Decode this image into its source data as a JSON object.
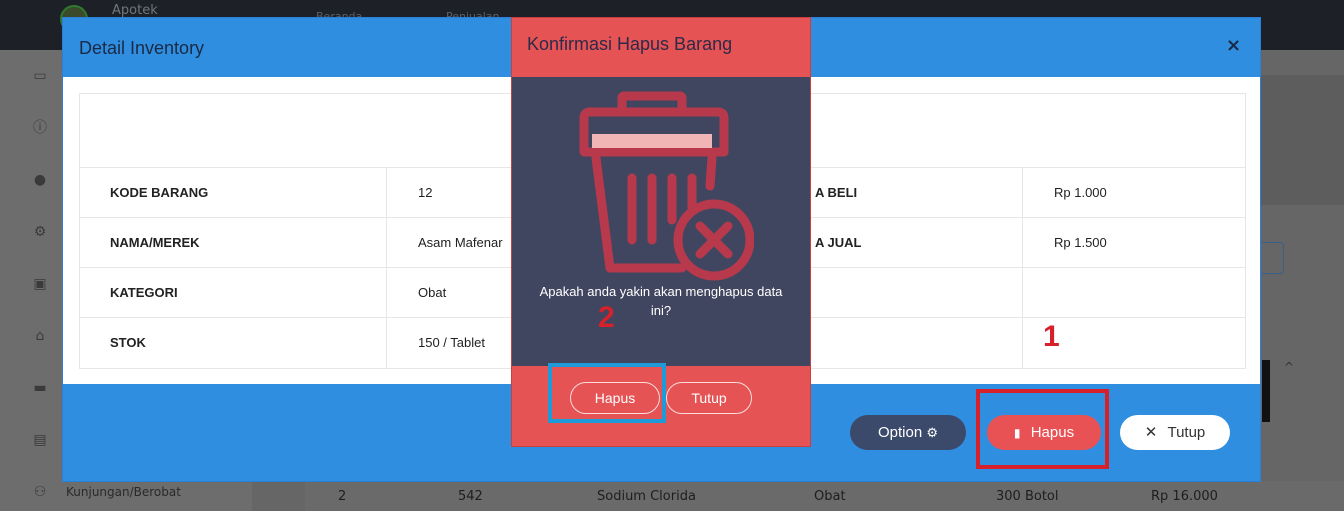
{
  "background": {
    "brand": "Apotek",
    "nav": [
      "Beranda",
      "Penjualan"
    ],
    "sidebar_item_label": "Kunjungan/Berobat",
    "table_row": [
      "2",
      "542",
      "Sodium Clorida",
      "Obat",
      "300 Botol",
      "Rp 16.000"
    ]
  },
  "modal": {
    "title": "Detail Inventory",
    "close": "×",
    "rows": [
      {
        "label": "KODE BARANG",
        "value": "12",
        "label2": "A BELI",
        "value2": "Rp 1.000"
      },
      {
        "label": "NAMA/MEREK",
        "value": "Asam Mafenar",
        "label2": "A JUAL",
        "value2": "Rp 1.500"
      },
      {
        "label": "KATEGORI",
        "value": "Obat"
      },
      {
        "label": "STOK",
        "value": "150 / Tablet"
      }
    ],
    "buttons": {
      "option": "Option",
      "hapus": "Hapus",
      "tutup": "Tutup"
    }
  },
  "confirm": {
    "title": "Konfirmasi Hapus Barang",
    "message": "Apakah anda yakin akan menghapus data ini?",
    "buttons": {
      "hapus": "Hapus",
      "tutup": "Tutup"
    }
  },
  "annotations": {
    "one": "1",
    "two": "2"
  },
  "colors": {
    "primary": "#2f8ee0",
    "danger": "#e55354",
    "dark": "#414660",
    "annotation_red": "#d6202a",
    "annotation_blue": "#1f9ad8"
  },
  "icons": [
    "home-icon",
    "info-icon",
    "user-icon",
    "gear-icon",
    "id-card-icon",
    "building-icon",
    "bed-icon",
    "badge-icon",
    "people-icon",
    "trash-icon",
    "close-icon",
    "times-icon"
  ]
}
